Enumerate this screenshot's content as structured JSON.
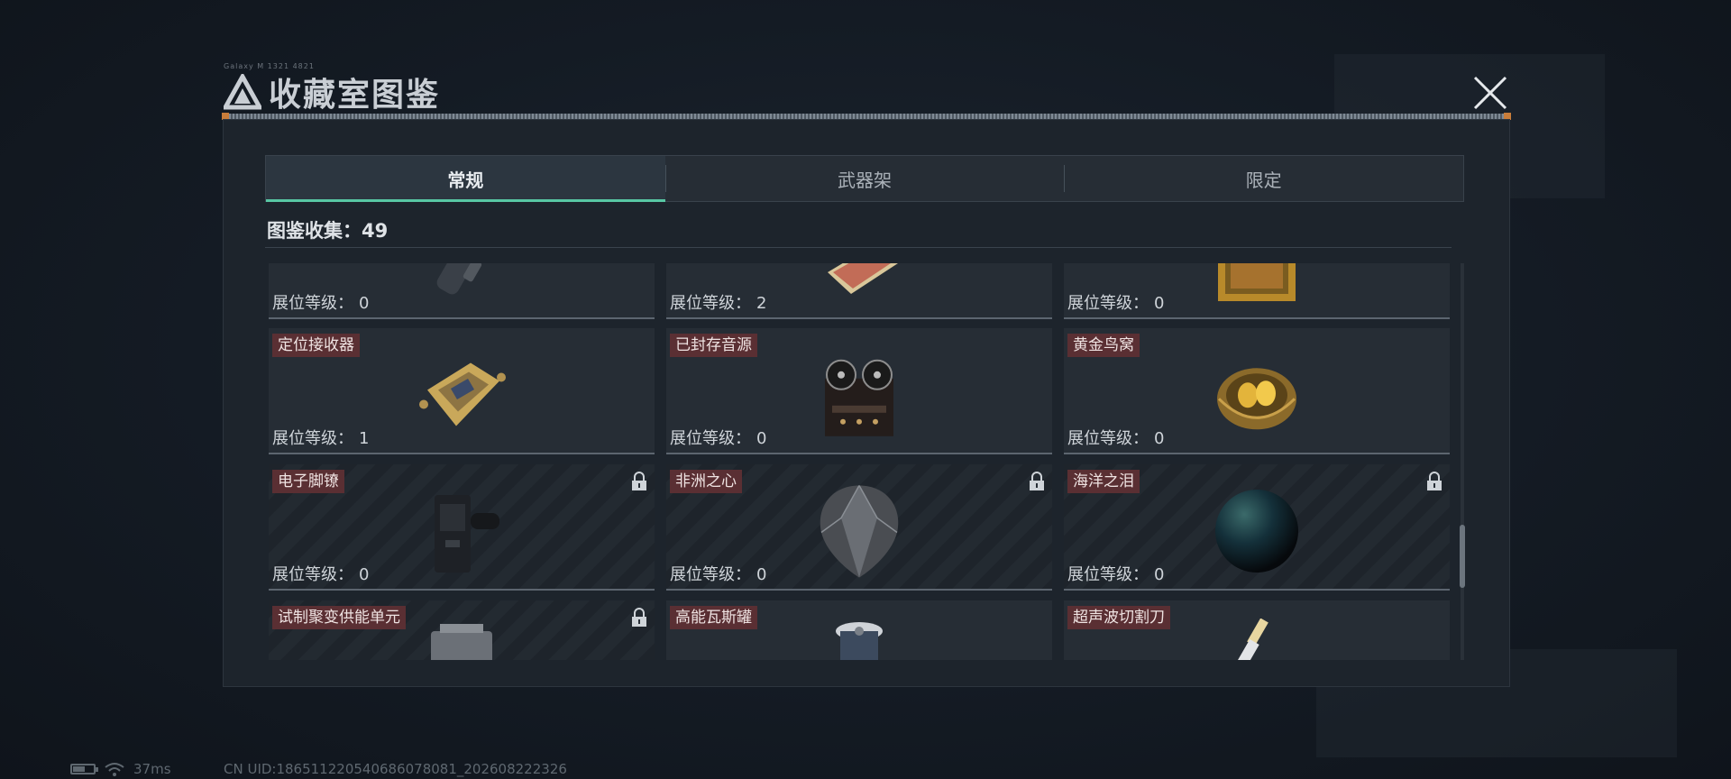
{
  "header": {
    "title": "收藏室图鉴",
    "micro_text": "Galaxy  M  1321 4821"
  },
  "tabs": [
    {
      "label": "常规",
      "active": true
    },
    {
      "label": "武器架",
      "active": false
    },
    {
      "label": "限定",
      "active": false
    }
  ],
  "collection": {
    "label": "图鉴收集：",
    "count": "49"
  },
  "level_label": "展位等级：",
  "items": [
    {
      "name": "",
      "level": "0",
      "locked": false,
      "icon": "grenade-icon"
    },
    {
      "name": "",
      "level": "2",
      "locked": false,
      "icon": "document-icon"
    },
    {
      "name": "",
      "level": "0",
      "locked": false,
      "icon": "golden-frame-icon"
    },
    {
      "name": "定位接收器",
      "level": "1",
      "locked": false,
      "icon": "receiver-icon"
    },
    {
      "name": "已封存音源",
      "level": "0",
      "locked": false,
      "icon": "tape-recorder-icon"
    },
    {
      "name": "黄金鸟窝",
      "level": "0",
      "locked": false,
      "icon": "golden-nest-icon"
    },
    {
      "name": "电子脚镣",
      "level": "0",
      "locked": true,
      "icon": "ankle-monitor-icon"
    },
    {
      "name": "非洲之心",
      "level": "0",
      "locked": true,
      "icon": "diamond-icon"
    },
    {
      "name": "海洋之泪",
      "level": "0",
      "locked": true,
      "icon": "pearl-icon"
    },
    {
      "name": "试制聚变供能单元",
      "level": "",
      "locked": true,
      "icon": "fusion-cell-icon"
    },
    {
      "name": "高能瓦斯罐",
      "level": "",
      "locked": false,
      "icon": "gas-canister-icon"
    },
    {
      "name": "超声波切割刀",
      "level": "",
      "locked": false,
      "icon": "ultrasonic-knife-icon"
    }
  ],
  "status": {
    "ping": "37ms",
    "uid": "CN UID:18651122054068607808​1_202608222326"
  },
  "colors": {
    "accent": "#58c7a4",
    "tag_bg": "#5a2f33",
    "panel": "#1d242c"
  }
}
